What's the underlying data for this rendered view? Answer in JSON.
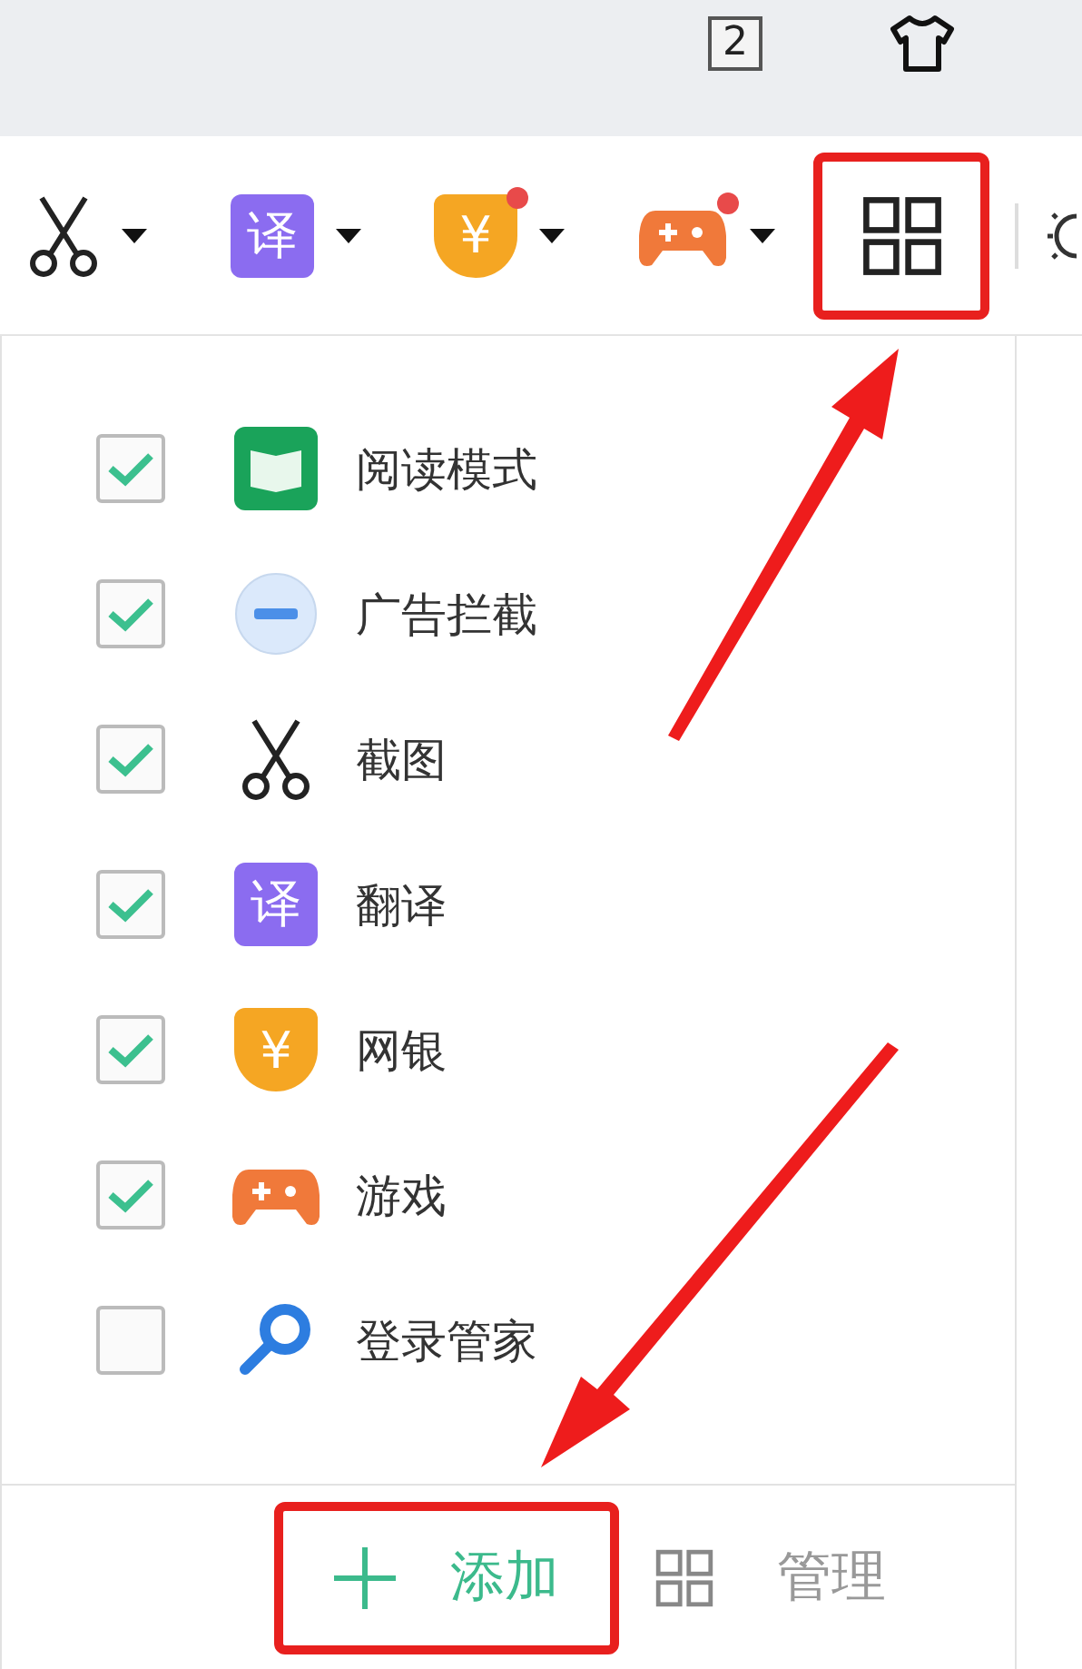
{
  "top_bar": {
    "tab_count": "2"
  },
  "toolbar": {
    "tools": [
      {
        "kind": "scissors",
        "notify": false
      },
      {
        "kind": "translate",
        "glyph": "译",
        "notify": false
      },
      {
        "kind": "bank",
        "glyph": "¥",
        "notify": true
      },
      {
        "kind": "game",
        "notify": true
      }
    ],
    "apps_button": {
      "highlighted": true
    }
  },
  "menu": {
    "items": [
      {
        "label": "阅读模式",
        "kind": "reader",
        "checked": true
      },
      {
        "label": "广告拦截",
        "kind": "adblock",
        "checked": true
      },
      {
        "label": "截图",
        "kind": "scissors",
        "checked": true
      },
      {
        "label": "翻译",
        "kind": "translate",
        "glyph": "译",
        "checked": true
      },
      {
        "label": "网银",
        "kind": "bank",
        "glyph": "¥",
        "checked": true
      },
      {
        "label": "游戏",
        "kind": "game",
        "checked": true
      },
      {
        "label": "登录管家",
        "kind": "search",
        "checked": false
      }
    ],
    "footer": {
      "add_button": {
        "label": "添加",
        "highlighted": true
      },
      "manage_button": {
        "label": "管理"
      }
    }
  }
}
